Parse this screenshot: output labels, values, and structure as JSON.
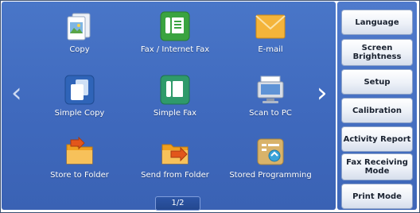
{
  "apps": [
    {
      "label": "Copy",
      "icon": "copy-icon"
    },
    {
      "label": "Fax / Internet Fax",
      "icon": "fax-icon"
    },
    {
      "label": "E-mail",
      "icon": "email-icon"
    },
    {
      "label": "Simple Copy",
      "icon": "simple-copy-icon"
    },
    {
      "label": "Simple Fax",
      "icon": "simple-fax-icon"
    },
    {
      "label": "Scan to PC",
      "icon": "scan-to-pc-icon"
    },
    {
      "label": "Store to Folder",
      "icon": "store-folder-icon"
    },
    {
      "label": "Send from Folder",
      "icon": "send-folder-icon"
    },
    {
      "label": "Stored Programming",
      "icon": "stored-programming-icon"
    }
  ],
  "pager": "1/2",
  "side_buttons": [
    {
      "label": "Language"
    },
    {
      "label": "Screen Brightness"
    },
    {
      "label": "Setup"
    },
    {
      "label": "Calibration"
    },
    {
      "label": "Activity Report"
    },
    {
      "label": "Fax Receiving Mode"
    },
    {
      "label": "Print Mode"
    }
  ],
  "colors": {
    "panel": "#4274c6",
    "side": "#476fc0",
    "fax_green": "#3aa340",
    "email_orange": "#f2a51c",
    "folder_orange": "#f0a020"
  }
}
